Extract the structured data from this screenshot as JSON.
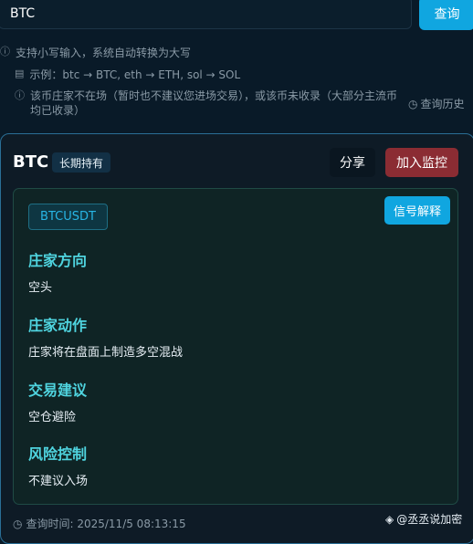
{
  "search": {
    "value": "BTC",
    "button_label": "查询"
  },
  "hints": {
    "line1": "支持小写输入，系统自动转换为大写",
    "line2": "示例：btc → BTC, eth → ETH, sol → SOL",
    "line3": "该币庄家不在场（暂时也不建议您进场交易），或该币未收录（大部分主流币均已收录）"
  },
  "history_label": "查询历史",
  "card": {
    "symbol": "BTC",
    "hold_badge": "长期持有",
    "share_label": "分享",
    "monitor_label": "加入监控",
    "pair": "BTCUSDT",
    "explain_label": "信号解释",
    "sections": [
      {
        "title": "庄家方向",
        "value": "空头"
      },
      {
        "title": "庄家动作",
        "value": "庄家将在盘面上制造多空混战"
      },
      {
        "title": "交易建议",
        "value": "空仓避险"
      },
      {
        "title": "风险控制",
        "value": "不建议入场"
      }
    ]
  },
  "query_time": "查询时间: 2025/11/5 08:13:15",
  "watermark": "@丞丞说加密",
  "colors": {
    "accent": "#10a6e0",
    "monitor": "#8b2c33",
    "section_title": "#4fd4df",
    "pair_text": "#28b5e5"
  },
  "icons": {
    "info": "info-icon",
    "doc": "document-icon",
    "warn": "warning-icon",
    "clock": "clock-icon",
    "logo": "diamond-logo-icon"
  }
}
